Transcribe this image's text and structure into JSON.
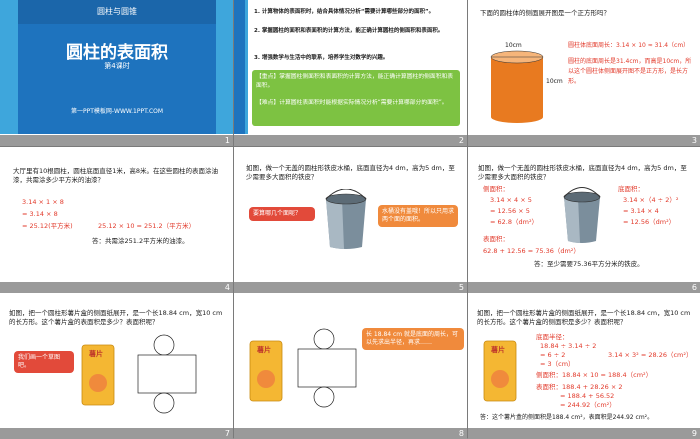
{
  "slides": {
    "s1": {
      "top": "圆柱与圆锥",
      "title": "圆柱的表面积",
      "sub": "第4课时",
      "footer": "第一PPT模板网-WWW.1PPT.COM",
      "num": "1"
    },
    "s2": {
      "items": [
        "1. 计算物体的表面积时，结合具体情况分析“需要计算哪些部分的面积”。",
        "2. 掌握圆柱的面积和表面积的计算方法，能正确计算圆柱的侧面积和表面积。",
        "3. 增强数学与生活中的联系，培养学生对数学的兴趣。"
      ],
      "box1": "【重点】掌握圆柱侧面积和表面积的计算方法，能正确计算圆柱的侧面积和表面积。",
      "box2": "【难点】计算圆柱表面积时能根据实际情况分析“需要计算哪部分的面积”。",
      "num": "2"
    },
    "s3": {
      "q": "下面的圆柱体的侧面展开图是一个正方形吗？",
      "dim1": "10cm",
      "dim2": "10cm",
      "a1": "圆柱体底面周长：3.14 × 10 ≈ 31.4（cm）",
      "a2": "圆柱的底面周长是31.4cm，而高是10cm，所以这个圆柱体侧面展开图不是正方形，是长方形。",
      "num": "3"
    },
    "s4": {
      "q": "大厅里有10根圆柱，圆柱底面直径1米，高8米。在这些圆柱的表面涂油漆，共需涂多少平方米的油漆？",
      "l1": "3.14 × 1 × 8",
      "l2": "= 3.14 × 8",
      "l3": "= 25.12(平方米)",
      "l4": "25.12 × 10 = 251.2（平方米）",
      "ans": "答：共需涂251.2平方米的油漆。",
      "num": "4"
    },
    "s5": {
      "q": "如图，做一个无盖的圆柱形铁皮水桶，底面直径为4 dm，高为5 dm，至少需要多大面积的铁皮？",
      "b1": "要算哪几个面呢？",
      "b2": "水桶没有盖哦！所以只用求两个面的面积。",
      "num": "5"
    },
    "s6": {
      "q": "如图，做一个无盖的圆柱形铁皮水桶，底面直径为4 dm，高为5 dm，至少需要多大面积的铁皮？",
      "side": "侧面积：",
      "side1": "3.14 × 4 × 5",
      "side2": "= 12.56 × 5",
      "side3": "= 62.8（dm²）",
      "base": "底面积：",
      "base1": "3.14 ×（4 ÷ 2）²",
      "base2": "= 3.14 × 4",
      "base3": "= 12.56（dm²）",
      "surf": "表面积：",
      "surf1": "62.8 + 12.56 = 75.36（dm²）",
      "ans": "答：至少需要75.36平方分米的铁皮。",
      "num": "6"
    },
    "s7": {
      "q": "如图，把一个圆柱形薯片盒的侧面纸展开，是一个长18.84 cm，宽10 cm的长方形。这个薯片盒的表面积是多少？表面积呢？",
      "bubble": "我们画一个草图吧。",
      "can": "薯片",
      "num": "7"
    },
    "s8": {
      "can": "薯片",
      "bubble": "长 18.84 cm 就是底面的周长，可以先求出半径，再求……",
      "num": "8"
    },
    "s9": {
      "q": "如图，把一个圆柱形薯片盒的侧面纸展开，是一个长18.84 cm，宽10 cm的长方形。这个薯片盒的侧面积是多少？表面积呢？",
      "can": "薯片",
      "r": "底面半径：",
      "r1": "18.84 ÷ 3.14 ÷ 2",
      "r2": "= 6 ÷ 2",
      "r3": "= 3（cm）",
      "b1": "3.14 × 3² = 28.26（cm²）",
      "side": "侧面积：18.84 × 10 = 188.4（cm²）",
      "surf": "表面积：188.4 + 28.26 × 2",
      "surf2": "= 188.4 + 56.52",
      "surf3": "= 244.92（cm²）",
      "ans": "答：这个薯片盒的侧面积是188.4 cm²，表面积是244.92 cm²。",
      "num": "9"
    }
  },
  "colors": {
    "blue": "#2b7fc7",
    "green": "#7dc242",
    "orange": "#f08a3c",
    "red": "#e23a2b",
    "gold": "#f4b733"
  },
  "icons": [
    "cylinder-icon",
    "bucket-icon",
    "chip-can-icon",
    "speech-bubble-icon"
  ]
}
